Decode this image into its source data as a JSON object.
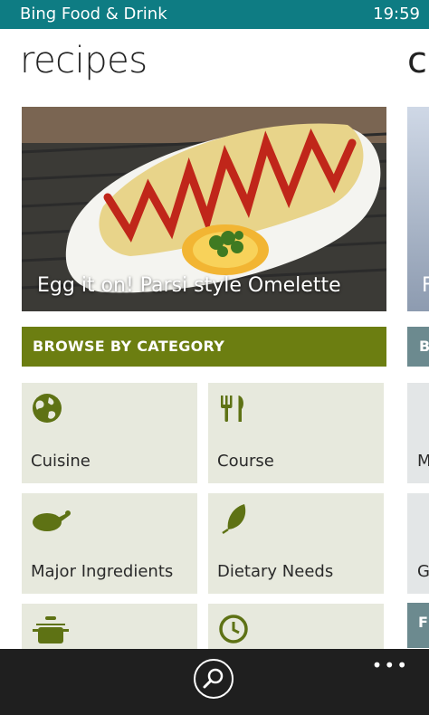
{
  "status_bar": {
    "app_name": "Bing Food & Drink",
    "time": "19:59"
  },
  "page": {
    "title": "recipes",
    "next_title_peek": "co"
  },
  "hero": {
    "caption": "Egg it on! Parsi style Omelette",
    "peek_caption_letter": "F"
  },
  "browse": {
    "header": "BROWSE BY CATEGORY",
    "tiles": [
      {
        "label": "Cuisine",
        "icon": "globe-icon"
      },
      {
        "label": "Course",
        "icon": "fork-knife-icon"
      },
      {
        "label": "Major Ingredients",
        "icon": "roast-chicken-icon"
      },
      {
        "label": "Dietary Needs",
        "icon": "leaf-icon"
      },
      {
        "label": "",
        "icon": "pot-icon"
      },
      {
        "label": "",
        "icon": "clock-icon"
      }
    ]
  },
  "peek_column": {
    "header_letter": "B",
    "tile_letters": [
      "M",
      "G"
    ],
    "footer_letter": "F"
  },
  "colors": {
    "status_bar": "#0e7c83",
    "category_header": "#6c7e11",
    "tile_bg": "#e7e9dd",
    "icon": "#5e7214",
    "app_bar": "#1f1f1f"
  },
  "app_bar": {
    "search_icon": "search-icon",
    "more_icon": "more-icon",
    "more_glyph": "•••"
  }
}
